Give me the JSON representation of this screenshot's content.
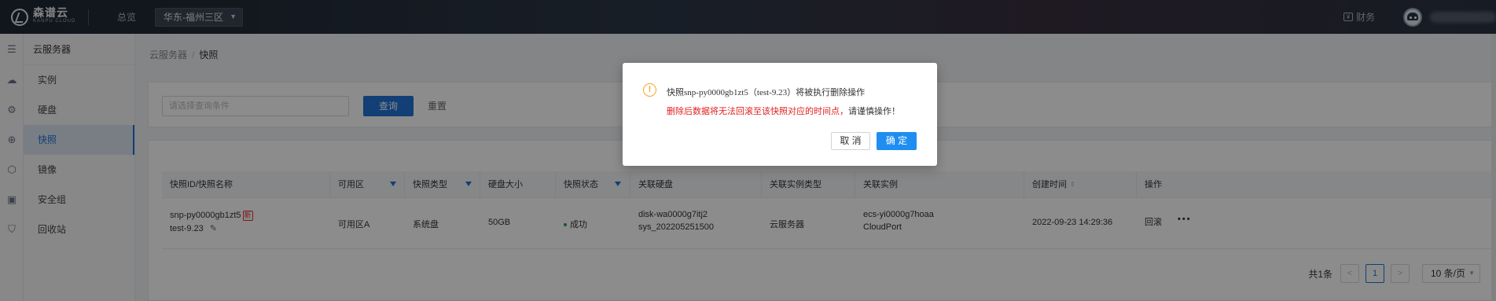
{
  "topbar": {
    "logo_cn": "森谱云",
    "logo_en": "KANPU CLOUD",
    "overview": "总览",
    "region": "华东-福州三区",
    "finance": "财务",
    "finance_icon_glyph": "¥"
  },
  "sidebar": {
    "title": "云服务器",
    "items": [
      {
        "label": "实例",
        "icon": "cloud-server-icon"
      },
      {
        "label": "硬盘",
        "icon": "disk-icon"
      },
      {
        "label": "快照",
        "icon": "snapshot-icon",
        "active": true
      },
      {
        "label": "镜像",
        "icon": "image-icon"
      },
      {
        "label": "安全组",
        "icon": "security-group-icon"
      },
      {
        "label": "回收站",
        "icon": "recycle-icon"
      }
    ]
  },
  "breadcrumb": {
    "parent": "云服务器",
    "separator": "/",
    "current": "快照"
  },
  "filter": {
    "search_placeholder": "请选择查询条件",
    "query_label": "查询",
    "reset_label": "重置"
  },
  "table": {
    "headers": [
      "快照ID/快照名称",
      "可用区",
      "快照类型",
      "硬盘大小",
      "快照状态",
      "关联硬盘",
      "关联实例类型",
      "关联实例",
      "创建时间",
      "操作"
    ],
    "row": {
      "snapshot_id": "snp-py0000gb1zt5",
      "new_badge": "新",
      "snapshot_name": "test-9.23",
      "zone": "可用区A",
      "type": "系统盘",
      "size": "50GB",
      "status": "成功",
      "disk_id": "disk-wa0000g7itj2",
      "disk_name": "sys_202205251500",
      "instance_type": "云服务器",
      "instance_id": "ecs-yi0000g7hoaa",
      "instance_name": "CloudPort",
      "created": "2022-09-23 14:29:36",
      "action_rollback": "回滚",
      "action_more": "•••"
    }
  },
  "pager": {
    "total": "共1条",
    "prev": "<",
    "page": "1",
    "next": ">",
    "size": "10 条/页"
  },
  "modal": {
    "message": "快照snp-py0000gb1zt5（test-9.23）将被执行删除操作",
    "warning": "删除后数据将无法回滚至该快照对应的时间点，",
    "warning_tail": "请谨慎操作！",
    "cancel_label": "取 消",
    "ok_label": "确 定"
  },
  "colors": {
    "accent": "#1f74d8",
    "warning": "#f5a623",
    "danger": "#e02020",
    "success": "#22a447"
  }
}
